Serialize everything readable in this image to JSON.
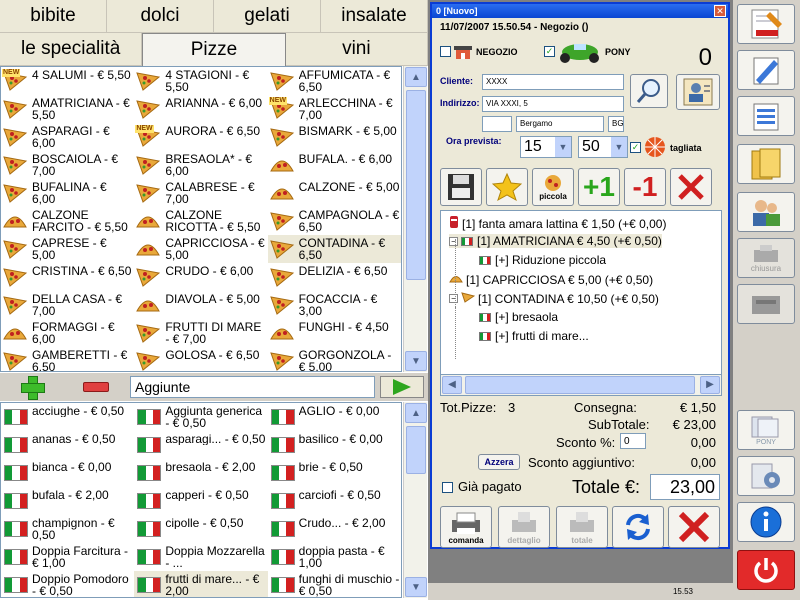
{
  "categories_row1": [
    "bibite",
    "dolci",
    "gelati",
    "insalate"
  ],
  "categories_row2": [
    "le specialità",
    "Pizze",
    "vini"
  ],
  "pizzas": [
    {
      "name": "4 SALUMI - € 5,50",
      "icon": "pizza-icon",
      "isNew": true,
      "selected": false
    },
    {
      "name": "4 STAGIONI - € 5,50",
      "icon": "pizza-slice-icon",
      "isNew": false,
      "selected": false
    },
    {
      "name": "AFFUMICATA - € 6,50",
      "icon": "pizza-slice-icon",
      "isNew": false,
      "selected": false
    },
    {
      "name": "AMATRICIANA - € 5,50",
      "icon": "pizza-slice-icon",
      "isNew": false,
      "selected": false
    },
    {
      "name": "ARIANNA - € 6,00",
      "icon": "pizza-slice-icon",
      "isNew": false,
      "selected": false
    },
    {
      "name": "ARLECCHINA - € 7,00",
      "icon": "pizza-icon",
      "isNew": true,
      "selected": false
    },
    {
      "name": "ASPARAGI - € 6,00",
      "icon": "pizza-slice-icon",
      "isNew": false,
      "selected": false
    },
    {
      "name": "AURORA - € 6,50",
      "icon": "pizza-icon",
      "isNew": true,
      "selected": false
    },
    {
      "name": "BISMARK - € 5,00",
      "icon": "pizza-slice-icon",
      "isNew": false,
      "selected": false
    },
    {
      "name": "BOSCAIOLA - € 7,00",
      "icon": "pizza-slice-icon",
      "isNew": false,
      "selected": false
    },
    {
      "name": "BRESAOLA* - € 6,00",
      "icon": "pizza-slice-icon",
      "isNew": false,
      "selected": false
    },
    {
      "name": "BUFALA. - € 6,00",
      "icon": "calzone-icon",
      "isNew": false,
      "selected": false
    },
    {
      "name": "BUFALINA - € 6,00",
      "icon": "pizza-slice-icon",
      "isNew": false,
      "selected": false
    },
    {
      "name": "CALABRESE - € 7,00",
      "icon": "pizza-slice-icon",
      "isNew": false,
      "selected": false
    },
    {
      "name": "CALZONE - € 5,00",
      "icon": "calzone-icon",
      "isNew": false,
      "selected": false
    },
    {
      "name": "CALZONE FARCITO - € 5,50",
      "icon": "calzone-icon",
      "isNew": false,
      "selected": false
    },
    {
      "name": "CALZONE RICOTTA - € 5,50",
      "icon": "calzone-icon",
      "isNew": false,
      "selected": false
    },
    {
      "name": "CAMPAGNOLA - € 6,50",
      "icon": "pizza-slice-icon",
      "isNew": false,
      "selected": false
    },
    {
      "name": "CAPRESE - € 5,00",
      "icon": "pizza-slice-icon",
      "isNew": false,
      "selected": false
    },
    {
      "name": "CAPRICCIOSA - € 5,00",
      "icon": "calzone-icon",
      "isNew": false,
      "selected": false
    },
    {
      "name": "CONTADINA - € 6,50",
      "icon": "pizza-slice-icon",
      "isNew": false,
      "selected": true
    },
    {
      "name": "CRISTINA - € 6,50",
      "icon": "pizza-slice-icon",
      "isNew": false,
      "selected": false
    },
    {
      "name": "CRUDO - € 6,00",
      "icon": "pizza-slice-icon",
      "isNew": false,
      "selected": false
    },
    {
      "name": "DELIZIA - € 6,50",
      "icon": "pizza-slice-icon",
      "isNew": false,
      "selected": false
    },
    {
      "name": "DELLA CASA - € 7,00",
      "icon": "pizza-slice-icon",
      "isNew": false,
      "selected": false
    },
    {
      "name": "DIAVOLA - € 5,00",
      "icon": "calzone-icon",
      "isNew": false,
      "selected": false
    },
    {
      "name": "FOCACCIA - € 3,00",
      "icon": "pizza-slice-icon",
      "isNew": false,
      "selected": false
    },
    {
      "name": "FORMAGGI - € 6,00",
      "icon": "calzone-icon",
      "isNew": false,
      "selected": false
    },
    {
      "name": "FRUTTI DI MARE - € 7,00",
      "icon": "pizza-slice-icon",
      "isNew": false,
      "selected": false
    },
    {
      "name": "FUNGHI - € 4,50",
      "icon": "calzone-icon",
      "isNew": false,
      "selected": false
    },
    {
      "name": "GAMBERETTI - € 6,50",
      "icon": "pizza-slice-icon",
      "isNew": false,
      "selected": false
    },
    {
      "name": "GOLOSA - € 6,50",
      "icon": "pizza-slice-icon",
      "isNew": false,
      "selected": false
    },
    {
      "name": "GORGONZOLA - € 5,00",
      "icon": "pizza-slice-icon",
      "isNew": false,
      "selected": false
    }
  ],
  "aggiunte": {
    "label": "Aggiunte"
  },
  "toppings": [
    {
      "name": "acciughe - € 0,50",
      "selected": false
    },
    {
      "name": "Aggiunta generica - € 0,50",
      "selected": false
    },
    {
      "name": "AGLIO - € 0,00",
      "selected": false
    },
    {
      "name": "ananas - € 0,50",
      "selected": false
    },
    {
      "name": "asparagi... - € 0,50",
      "selected": false
    },
    {
      "name": "basilico - € 0,00",
      "selected": false
    },
    {
      "name": "bianca - € 0,00",
      "selected": false
    },
    {
      "name": "bresaola - € 2,00",
      "selected": false
    },
    {
      "name": "brie - € 0,50",
      "selected": false
    },
    {
      "name": "bufala - € 2,00",
      "selected": false
    },
    {
      "name": "capperi - € 0,50",
      "selected": false
    },
    {
      "name": "carciofi - € 0,50",
      "selected": false
    },
    {
      "name": "champignon - € 0,50",
      "selected": false
    },
    {
      "name": "cipolle - € 0,50",
      "selected": false
    },
    {
      "name": "Crudo... - € 2,00",
      "selected": false
    },
    {
      "name": "Doppia Farcitura - € 1,00",
      "selected": false
    },
    {
      "name": "Doppia Mozzarella - ...",
      "selected": false
    },
    {
      "name": "doppia pasta - € 1,00",
      "selected": false
    },
    {
      "name": "Doppio Pomodoro - € 0,50",
      "selected": false
    },
    {
      "name": "frutti di mare... - € 2,00",
      "selected": true
    },
    {
      "name": "funghi di muschio - € 0,50",
      "selected": false
    }
  ],
  "window": {
    "title": "0 [Nuovo]",
    "info_line": "11/07/2007 15.50.54 - Negozio ()",
    "negozio_label": "NEGOZIO",
    "pony_label": "PONY",
    "order_number": "0",
    "cliente_label": "Cliente:",
    "cliente_value": "XXXX",
    "indirizzo_label": "Indirizzo:",
    "indirizzo_value": "VIA XXXI, 5",
    "city_value": "Bergamo",
    "province_value": "BG",
    "ora_label": "Ora prevista:",
    "hour": "15",
    "minute": "50",
    "tagliata_label": "tagliata",
    "piccola_label": "piccola",
    "plus_one": "+1",
    "minus_one": "-1"
  },
  "order_lines": [
    {
      "text": "[1] fanta amara lattina € 1,50  (+€ 0,00)",
      "icon": "can-icon",
      "level": 0,
      "selected": false
    },
    {
      "text": "[1] AMATRICIANA € 4,50  (+€ 0,50)",
      "icon": "flag-icon",
      "level": 0,
      "selected": true
    },
    {
      "text": "[+] Riduzione piccola",
      "icon": "flag-icon",
      "level": 1,
      "selected": false
    },
    {
      "text": "[1] CAPRICCIOSA € 5,00  (+€ 0,50)",
      "icon": "calzone-icon",
      "level": 0,
      "selected": false
    },
    {
      "text": "[1] CONTADINA € 10,50  (+€ 0,50)",
      "icon": "pizza-slice-icon",
      "level": 0,
      "selected": false
    },
    {
      "text": "[+] bresaola",
      "icon": "flag-icon",
      "level": 1,
      "selected": false
    },
    {
      "text": "[+] frutti di mare...",
      "icon": "flag-icon",
      "level": 1,
      "selected": false
    }
  ],
  "totals": {
    "tot_pizze_label": "Tot.Pizze:",
    "tot_pizze_value": "3",
    "consegna_label": "Consegna:",
    "consegna_value": "€ 1,50",
    "subtotale_label": "SubTotale:",
    "subtotale_value": "€ 23,00",
    "sconto_pct_label": "Sconto %:",
    "sconto_pct_value": "0",
    "sconto_pct_amount": "0,00",
    "azzera_label": "Azzera",
    "sconto_agg_label": "Sconto aggiuntivo:",
    "sconto_agg_value": "0,00",
    "gia_pagato_label": "Già pagato",
    "totale_label": "Totale €:",
    "totale_value": "23,00"
  },
  "bottom_buttons": {
    "comanda": "comanda",
    "dettaglio": "dettaglio",
    "totale": "totale"
  },
  "status_time": "15.53",
  "right_bar": {
    "chiusura": "chiusura",
    "pony": "PONY"
  },
  "colors": {
    "title_blue": "#0a46d2",
    "flag_green": "#129a36",
    "flag_red": "#d32020",
    "accent_green": "#3dbb2a"
  }
}
